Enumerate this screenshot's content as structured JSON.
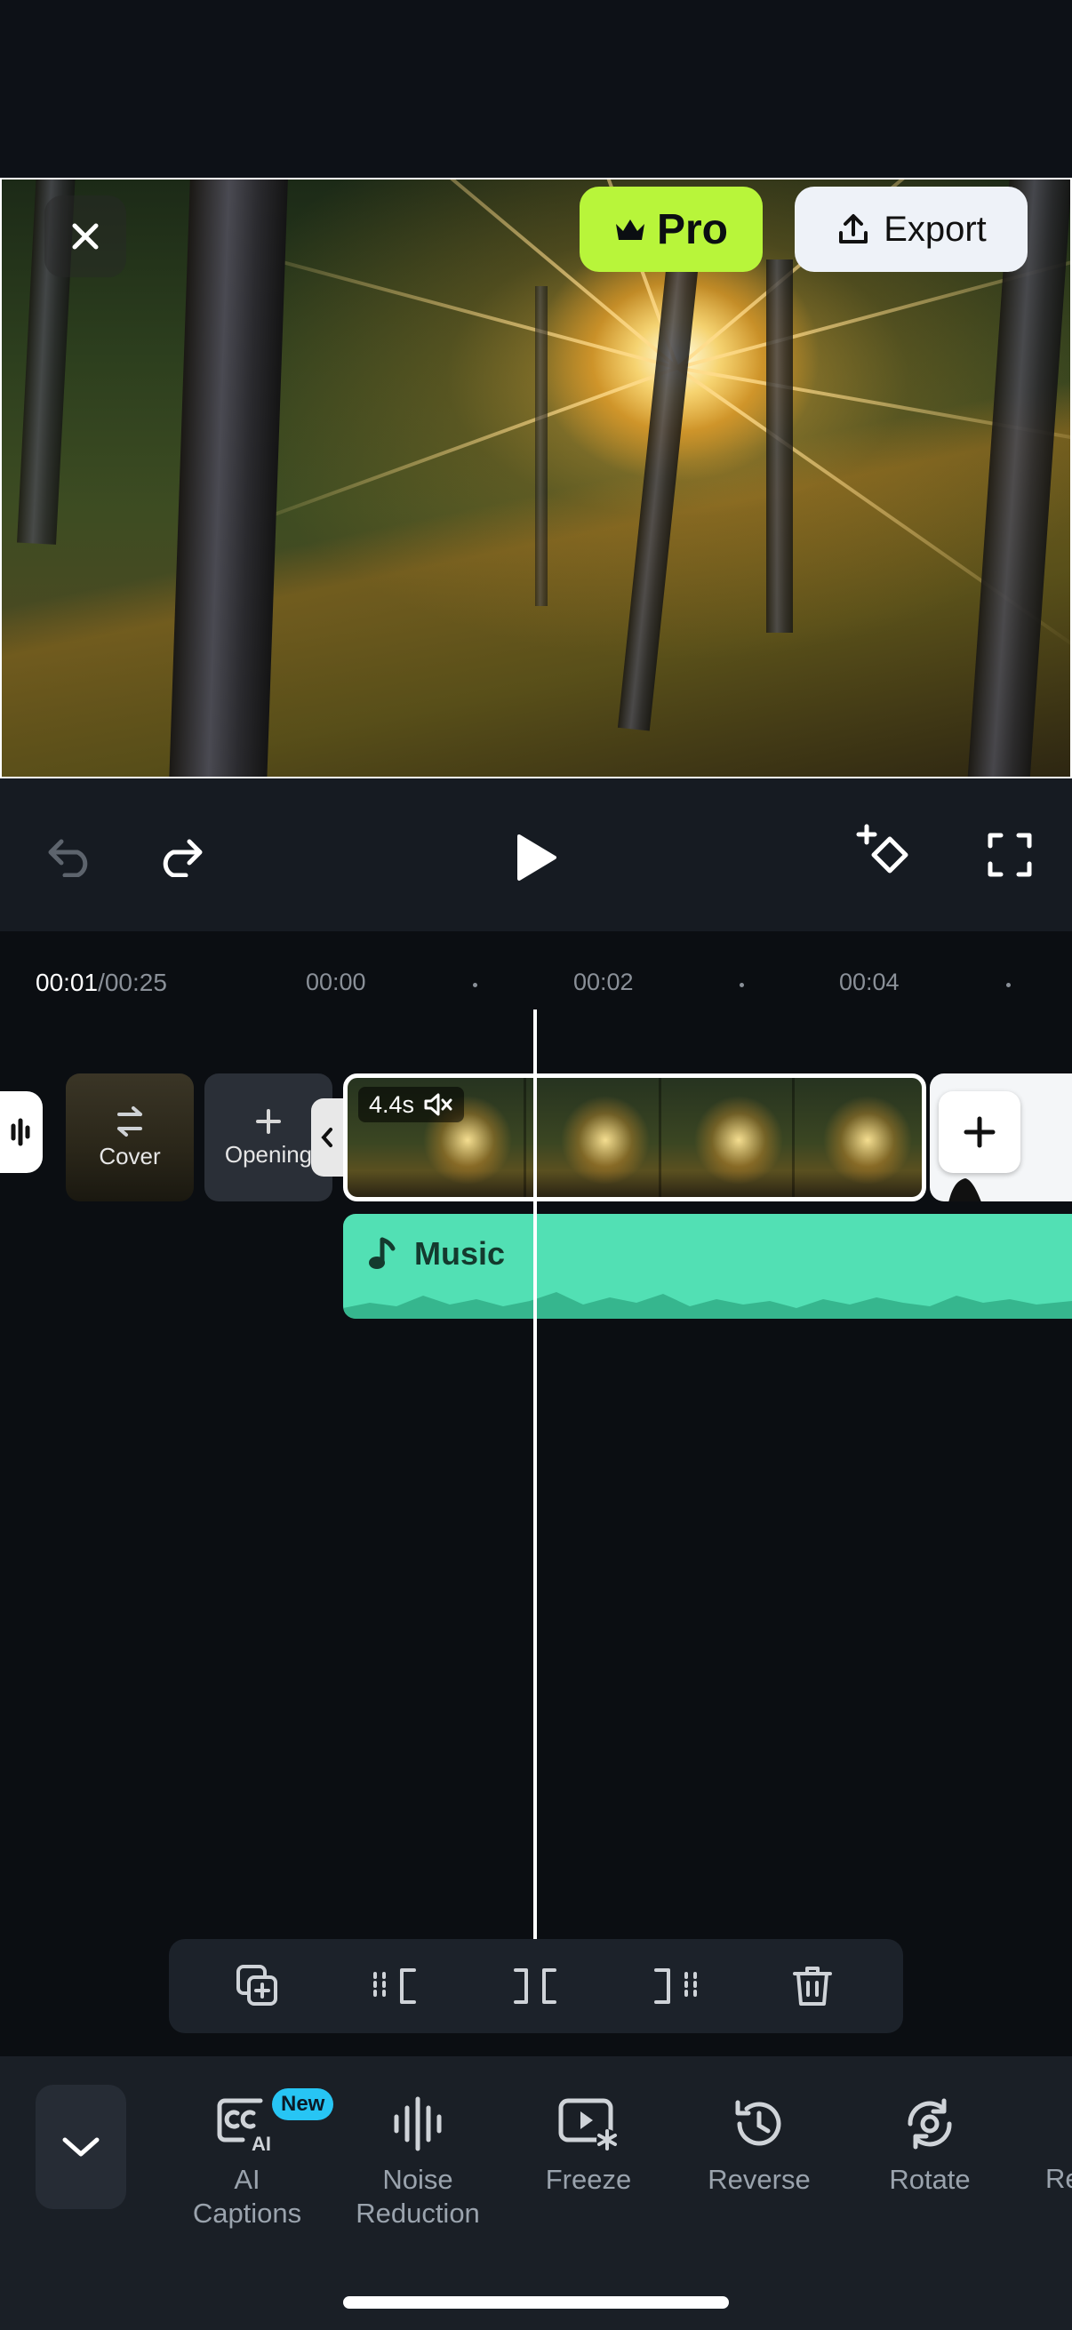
{
  "header": {
    "pro_label": "Pro",
    "export_label": "Export"
  },
  "controls": {
    "current_time": "00:01",
    "total_time": "/00:25"
  },
  "timeline": {
    "ruler": [
      "00:00",
      "00:02",
      "00:04"
    ],
    "cover_label": "Cover",
    "opening_label": "Opening",
    "clip_duration": "4.4s",
    "music_label": "Music"
  },
  "tools": [
    {
      "label": "AI\nCaptions",
      "icon": "ai-captions-icon",
      "badge": "New"
    },
    {
      "label": "Noise\nReduction",
      "icon": "noise-reduction-icon"
    },
    {
      "label": "Freeze",
      "icon": "freeze-icon"
    },
    {
      "label": "Reverse",
      "icon": "reverse-icon"
    },
    {
      "label": "Rotate",
      "icon": "rotate-icon"
    },
    {
      "label": "Re",
      "icon": "more-icon"
    }
  ],
  "colors": {
    "pro": "#b8f53a",
    "music": "#52e0b4",
    "new_badge": "#27c5f4",
    "background": "#0b0e12"
  }
}
